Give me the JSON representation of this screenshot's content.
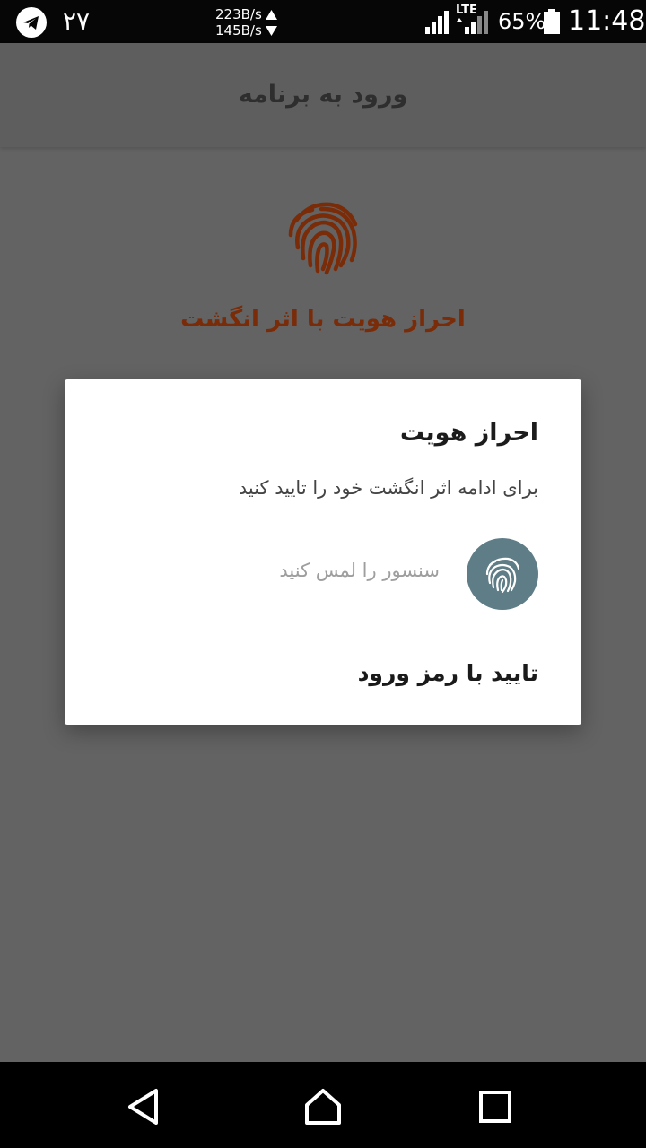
{
  "status_bar": {
    "app_icon": "telegram-icon",
    "notification_count": "۲۷",
    "upload_speed": "223B/s",
    "download_speed": "145B/s",
    "network_type": "LTE",
    "battery_percent": "65%",
    "time": "11:48"
  },
  "app_bar": {
    "title": "ورود به برنامه"
  },
  "page": {
    "icon": "fingerprint-icon",
    "heading": "احراز هویت با اثر انگشت",
    "accent_color": "#7a2b08"
  },
  "dialog": {
    "title": "احراز هویت",
    "subtitle": "برای ادامه اثر انگشت خود را تایید کنید",
    "sensor_icon": "fingerprint-icon",
    "sensor_hint": "سنسور را لمس کنید",
    "password_button": "تایید با رمز ورود",
    "sensor_color": "#5f7d87"
  },
  "nav_bar": {
    "back": "back-icon",
    "home": "home-icon",
    "recent": "recent-apps-icon"
  }
}
